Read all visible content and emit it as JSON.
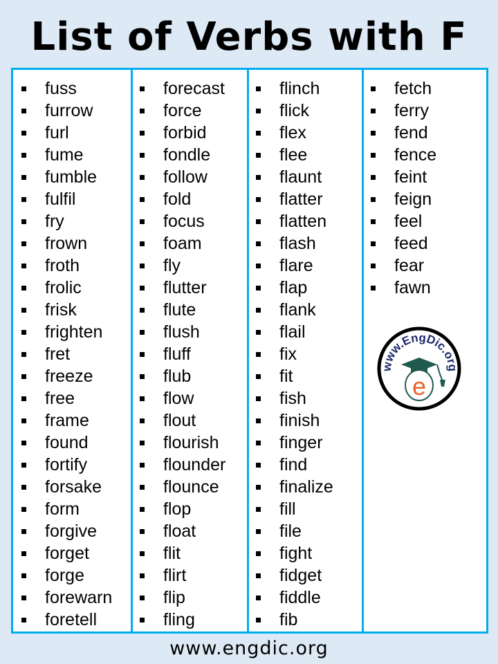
{
  "title": "List of Verbs with F",
  "columns": [
    [
      "fuss",
      "furrow",
      "furl",
      "fume",
      "fumble",
      "fulfil",
      "fry",
      "frown",
      "froth",
      "frolic",
      "frisk",
      "frighten",
      "fret",
      "freeze",
      "free",
      "frame",
      "found",
      "fortify",
      "forsake",
      "form",
      "forgive",
      "forget",
      "forge",
      "forewarn",
      "foretell"
    ],
    [
      "forecast",
      "force",
      "forbid",
      "fondle",
      "follow",
      "fold",
      "focus",
      "foam",
      "fly",
      "flutter",
      "flute",
      "flush",
      "fluff",
      "flub",
      "flow",
      "flout",
      "flourish",
      "flounder",
      "flounce",
      "flop",
      "float",
      "flit",
      "flirt",
      "flip",
      "fling"
    ],
    [
      "flinch",
      "flick",
      "flex",
      "flee",
      "flaunt",
      "flatter",
      "flatten",
      "flash",
      "flare",
      "flap",
      "flank",
      "flail",
      "fix",
      "fit",
      "fish",
      "finish",
      "finger",
      "find",
      "finalize",
      "fill",
      "file",
      "fight",
      "fidget",
      "fiddle",
      "fib"
    ],
    [
      "fetch",
      "ferry",
      "fend",
      "fence",
      "feint",
      "feign",
      "feel",
      "feed",
      "fear",
      "fawn"
    ]
  ],
  "logo": {
    "text": "www.EngDic.org",
    "icon": "graduation-cap-e-logo",
    "colors": {
      "ring": "#000000",
      "text": "#1b2a6b",
      "cap": "#1e5a4e",
      "letter": "#e8652a"
    }
  },
  "footer": "www.engdic.org",
  "colors": {
    "background": "#dde9f5",
    "border": "#00aeef",
    "text": "#000000"
  }
}
